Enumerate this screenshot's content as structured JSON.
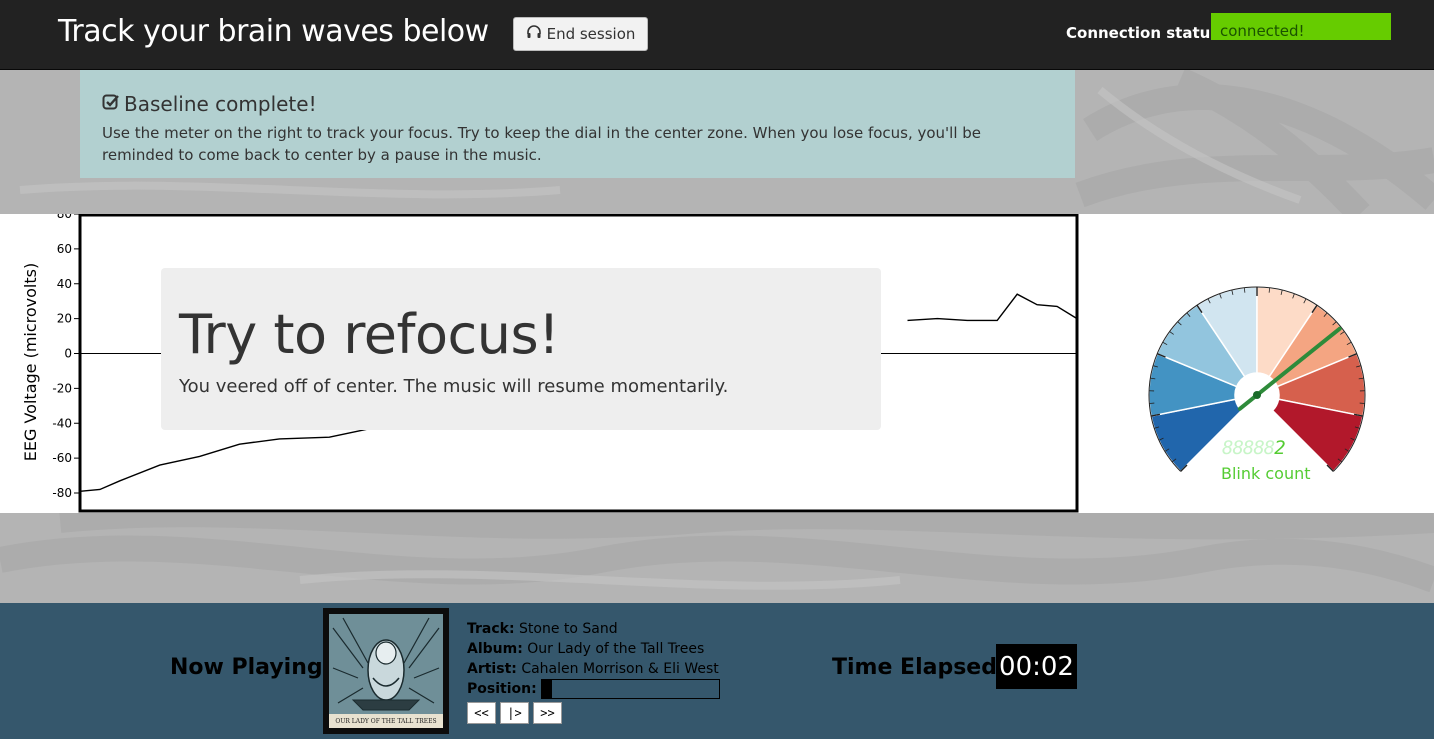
{
  "navbar": {
    "title": "Track your brain waves below",
    "end_session_label": "End session",
    "connection_label": "Connection status:",
    "connection_value": "connected!"
  },
  "alert": {
    "icon": "check-square-icon",
    "title": "Baseline complete!",
    "body": "Use the meter on the right to track your focus. Try to keep the dial in the center zone. When you lose focus, you'll be reminded to come back to center by a pause in the music."
  },
  "refocus": {
    "title": "Try to refocus!",
    "message": "You veered off of center. The music will resume momentarily."
  },
  "chart_data": {
    "type": "line",
    "ylabel": "EEG Voltage (microvolts)",
    "ylim": [
      -80,
      80
    ],
    "yticks": [
      "80",
      "60",
      "40",
      "20",
      "0",
      "-20",
      "-40",
      "-60",
      "-80"
    ],
    "ytick_values": [
      80,
      60,
      40,
      20,
      0,
      -20,
      -40,
      -60,
      -80
    ],
    "grid": false,
    "series": [
      {
        "x": [
          0,
          2,
          4,
          8,
          12,
          16,
          20,
          25,
          30,
          35,
          40,
          45,
          50,
          55,
          60,
          65,
          70,
          75,
          80,
          83,
          86,
          89,
          92,
          94,
          96,
          98,
          100
        ],
        "values": [
          -79,
          -78,
          -73,
          -64,
          -59,
          -52,
          -49,
          -48,
          -42,
          null,
          null,
          null,
          null,
          null,
          null,
          null,
          null,
          null,
          null,
          19,
          20,
          19,
          19,
          34,
          28,
          27,
          20
        ]
      }
    ]
  },
  "gauge": {
    "needle_value": 0.69,
    "segment_colors": [
      "#2166ac",
      "#4393c3",
      "#92c5de",
      "#d1e5f0",
      "#fddbc7",
      "#f4a582",
      "#d6604d",
      "#b2182b"
    ],
    "needle_color": "#2e8b3a",
    "blink_digits_ghost": "88888",
    "blink_digits_lit": "2",
    "blink_label": "Blink count"
  },
  "player": {
    "now_playing_label": "Now Playing:",
    "album_art_icon": "album-cover-image",
    "album_art_caption": "OUR LADY OF THE TALL TREES",
    "track_label": "Track:",
    "track": "Stone to Sand",
    "album_label": "Album:",
    "album": "Our Lady of the Tall Trees",
    "artist_label": "Artist:",
    "artist": "Cahalen Morrison & Eli West",
    "position_label": "Position:",
    "position_fraction": 0.06,
    "prev_label": "<<",
    "play_label": "|>",
    "next_label": ">>",
    "time_label": "Time Elapsed:",
    "time_value": "00:02"
  }
}
